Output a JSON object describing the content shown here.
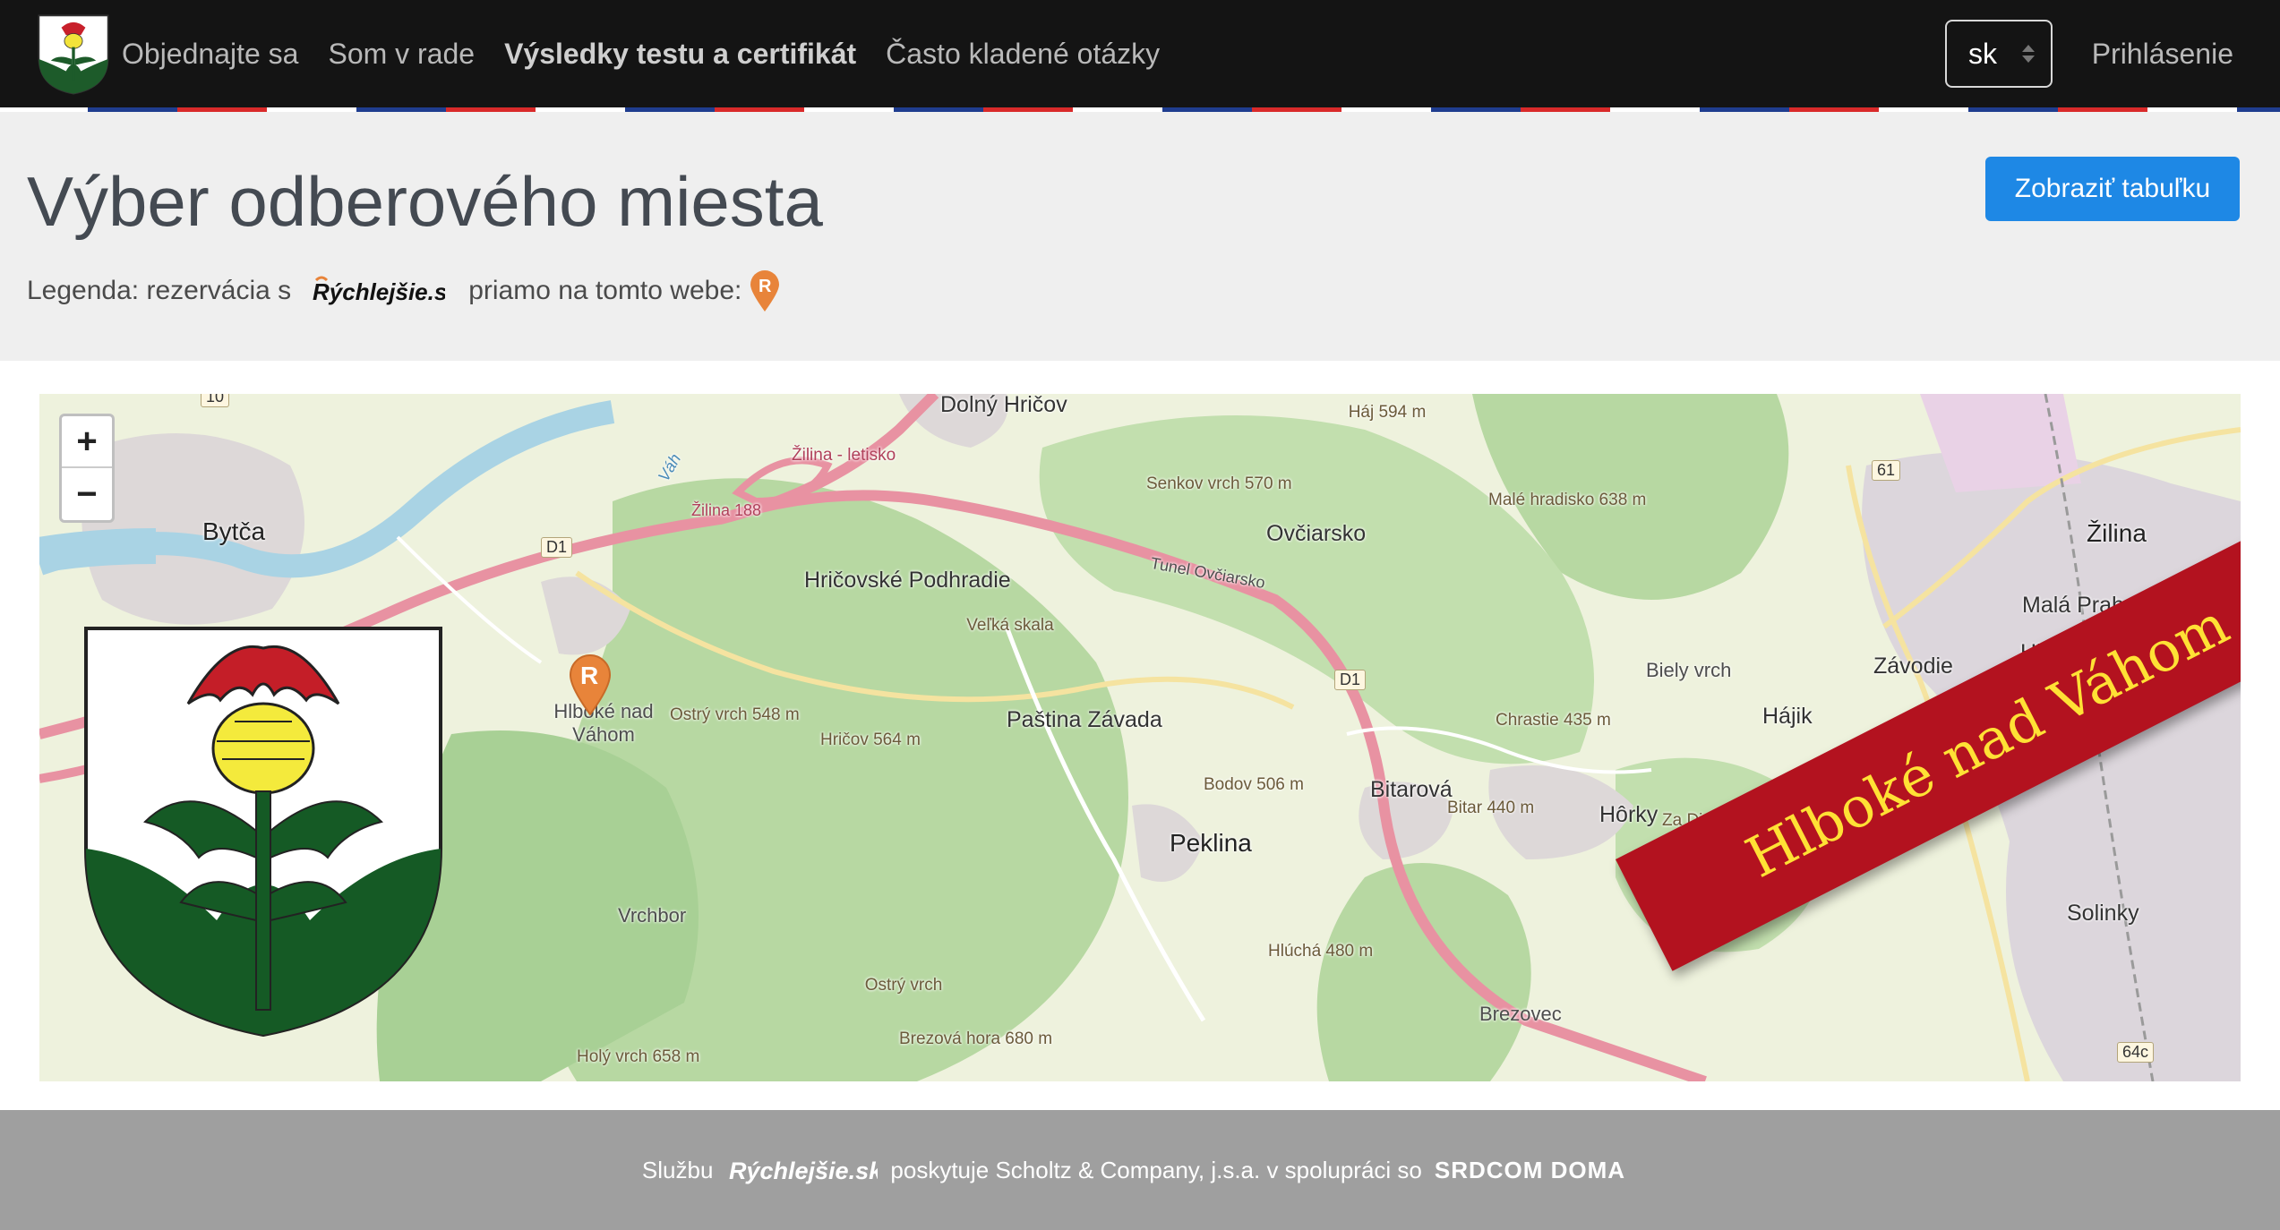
{
  "nav": {
    "links": [
      "Objednajte sa",
      "Som v rade",
      "Výsledky testu a certifikát",
      "Často kladené otázky"
    ],
    "language": "sk",
    "login": "Prihlásenie"
  },
  "colors": {
    "navbar": "#141414",
    "primary_button": "#1e88e5",
    "ribbon": "#b3121f",
    "ribbon_text": "#ffe135",
    "footer": "#9f9f9f",
    "marker": "#e8843a"
  },
  "header": {
    "title": "Výber odberového miesta",
    "show_table_button": "Zobraziť tabuľku",
    "legend_prefix": "Legenda: rezervácia s",
    "legend_brand": "Rýchlejšie.sk",
    "legend_suffix": "priamo na tomto webe:",
    "legend_icon": "orange-r-pin-icon"
  },
  "map": {
    "zoom_in": "+",
    "zoom_out": "−",
    "ribbon_text": "Hlboké nad Váhom",
    "places": [
      "Bytča",
      "Dolný Hričov",
      "Ovčiarsko",
      "Žilina",
      "Malá Praha",
      "Hliny VIII",
      "Hričovské Podhradie",
      "Paština Závada",
      "Peklina",
      "Bitarová",
      "Hôrky",
      "Závodie",
      "Hájik",
      "Solinky",
      "Brezovec",
      "Biely vrch",
      "Vrchbor",
      "Hlboké nad Váhom"
    ],
    "peaks": [
      "Háj 594 m",
      "Senkov vrch 570 m",
      "Malé hradisko 638 m",
      "Veľká skala",
      "Ostrý vrch 548 m",
      "Hričov 564 m",
      "Chrastie 435 m",
      "Bodov 506 m",
      "Bitar 440 m",
      "Za Dielom 416 m",
      "Hlúchá 480 m",
      "Ostrý vrch",
      "Brezová hora 680 m",
      "Holý vrch 658 m"
    ],
    "road_labels": [
      "D1",
      "D1",
      "61",
      "64c",
      "10"
    ],
    "other_labels": [
      "Žilina - letisko",
      "Tunel Ovčiarsko",
      "Žilina 188",
      "Váh"
    ]
  },
  "footer": {
    "prefix": "Službu",
    "brand": "Rýchlejšie.sk",
    "text": "poskytuje Scholtz & Company, j.s.a. v spolupráci so",
    "partner": "SRDCOM DOMA"
  }
}
